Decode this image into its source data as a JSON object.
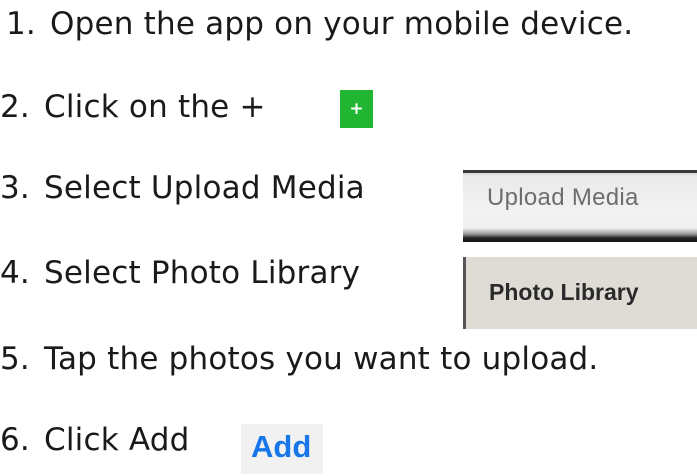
{
  "steps": [
    {
      "num": "1.",
      "text": "Open the app on your mobile device."
    },
    {
      "num": "2.",
      "text": "Click on the +"
    },
    {
      "num": "3.",
      "text": "Select Upload Media"
    },
    {
      "num": "4.",
      "text": "Select Photo Library"
    },
    {
      "num": "5.",
      "text": "Tap the photos you want to upload."
    },
    {
      "num": "6.",
      "text": "Click Add"
    }
  ],
  "thumbnails": {
    "plus_button": {
      "label": "+",
      "color": "#22b532"
    },
    "upload_media": {
      "label": "Upload Media"
    },
    "photo_library": {
      "label": "Photo Library"
    },
    "add_button": {
      "label": "Add",
      "color": "#1877e8"
    }
  }
}
